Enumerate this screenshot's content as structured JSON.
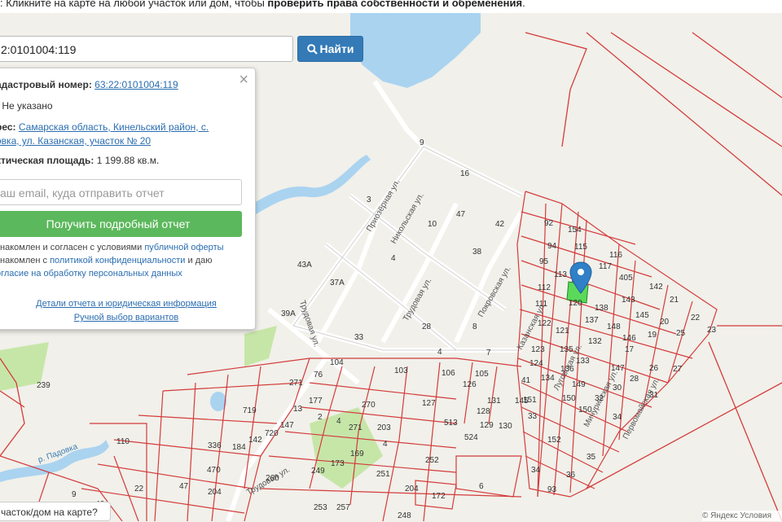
{
  "topbar": {
    "text_prefix": ": Кликните на карте на любой участок или дом, чтобы ",
    "text_bold": "проверить права собственности и обременения",
    "text_suffix": "."
  },
  "search": {
    "value": "2:0101004:119",
    "button_label": "Найти"
  },
  "popup": {
    "cadastral_label": "адастровый номер:",
    "cadastral_value": "63:22:0101004:119",
    "type_label": ":",
    "type_value": "Не указано",
    "address_label": "рес:",
    "address_line1": "Самарская область, Кинельский район, с.",
    "address_line2": "овка, ул. Казанская, участок № 20",
    "area_label": "ктическая площадь:",
    "area_value": "1 199.88 кв.м.",
    "email_placeholder": "аш email, куда отправить отчет",
    "report_button": "Получить подробный отчет",
    "agree1_prefix": "знакомлен и согласен с условиями ",
    "agree1_link": "публичной оферты",
    "agree2_prefix": "знакомлен с ",
    "agree2_link": "политикой конфиденциальности",
    "agree2_suffix": " и даю",
    "agree3_link": "огласие на обработку персональных данных",
    "details_link": "Детали отчета и юридическая информация",
    "manual_link": "Ручной выбор вариантов",
    "close": "×"
  },
  "bottom_tip": "часток/дом на карте?",
  "attribution": "© Яндекс  Условия",
  "map": {
    "streets": [
      "Приозёрная ул.",
      "Никольская ул.",
      "Трудовая ул.",
      "Покровская ул.",
      "Трудовая ул.",
      "Казанская ул.",
      "Луговская ул.",
      "Мичуринская ул.",
      "Первомайская ул.",
      "Трудовая ул.",
      "р. Падовка"
    ],
    "numbers": [
      "9",
      "16",
      "3",
      "47",
      "10",
      "42",
      "38",
      "4",
      "43А",
      "37А",
      "39А",
      "33",
      "28",
      "8",
      "4",
      "7",
      "239",
      "92",
      "154",
      "94",
      "115",
      "116",
      "95",
      "117",
      "405",
      "113",
      "142",
      "112",
      "120",
      "138",
      "111",
      "137",
      "143",
      "21",
      "122",
      "145",
      "20",
      "22",
      "121",
      "123",
      "135",
      "17",
      "19",
      "25",
      "23",
      "124",
      "132",
      "133",
      "136",
      "148",
      "26",
      "27",
      "41",
      "146",
      "149",
      "134",
      "150",
      "147",
      "30",
      "28",
      "31",
      "150",
      "151",
      "32",
      "152",
      "33",
      "34",
      "34",
      "35",
      "36",
      "93",
      "104",
      "76",
      "271",
      "103",
      "106",
      "105",
      "126",
      "131",
      "145",
      "270",
      "127",
      "128",
      "129",
      "130",
      "719",
      "147",
      "720",
      "336",
      "271",
      "513",
      "524",
      "110",
      "184",
      "142",
      "173",
      "252",
      "251",
      "204",
      "172",
      "6",
      "470",
      "47",
      "204",
      "260",
      "249",
      "248",
      "22",
      "9",
      "46",
      "253",
      "257",
      "169",
      "4",
      "203",
      "13",
      "177",
      "2",
      "4"
    ]
  },
  "colors": {
    "parcel": "#d43b3b",
    "water": "#aad3f0",
    "green": "#c6e6a8",
    "accent": "#337ab7",
    "button_green": "#5cb85c",
    "marker": "#2f80c7",
    "selected": "#5bd95b"
  }
}
